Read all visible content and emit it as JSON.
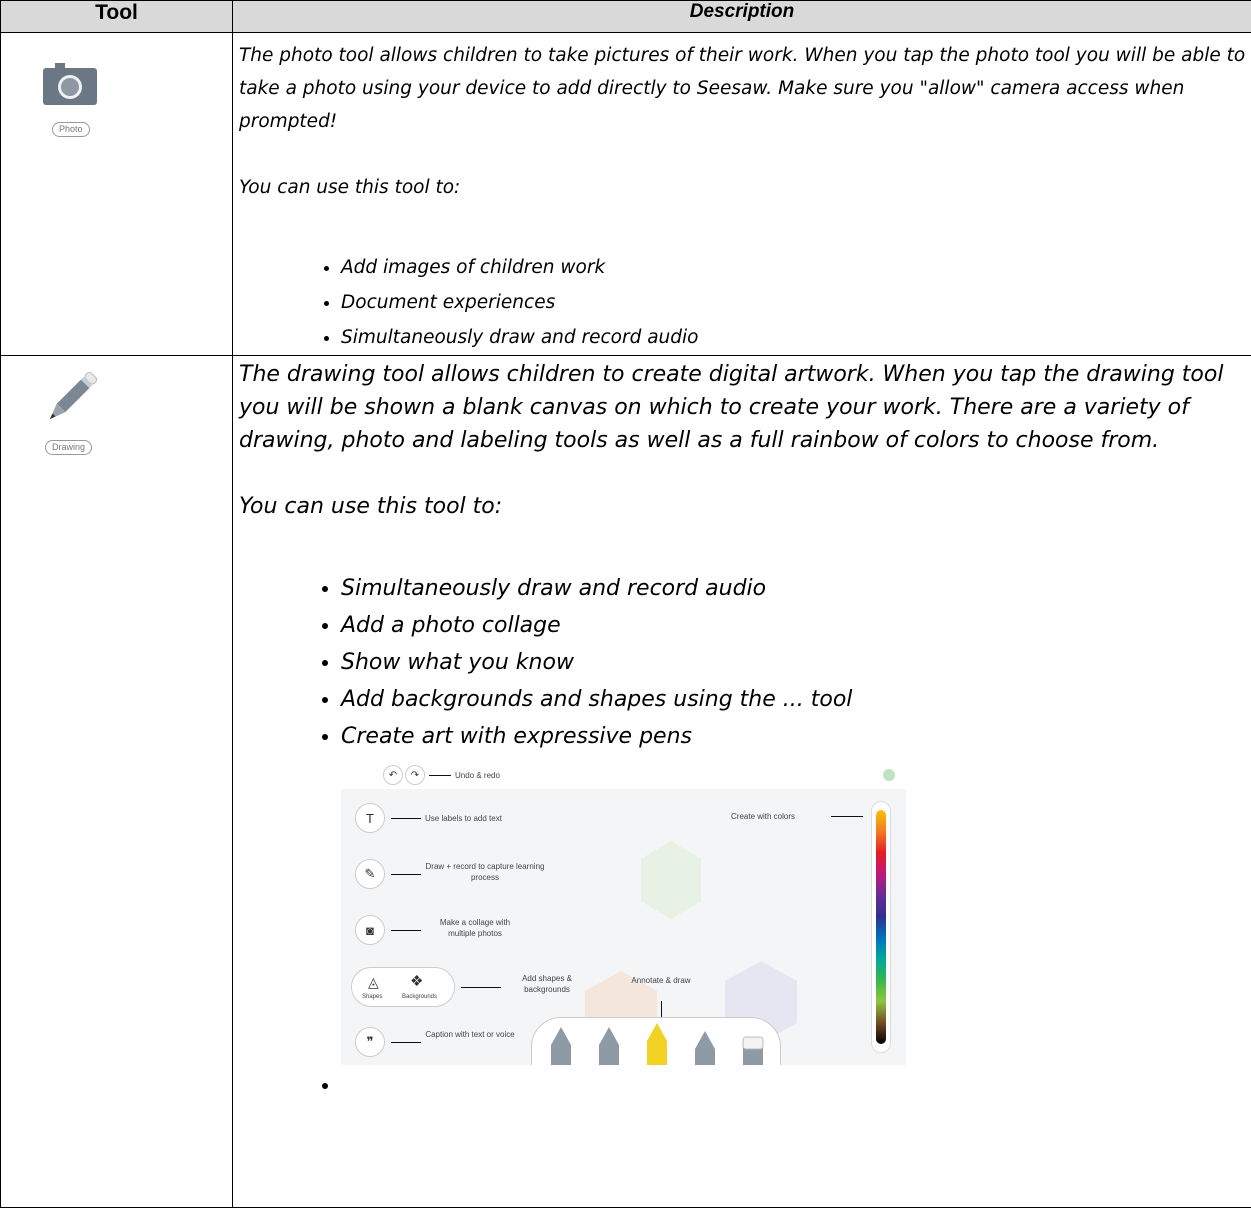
{
  "header": {
    "tool": "Tool",
    "description": "Description"
  },
  "rows": [
    {
      "tool_icon": "camera-icon",
      "tool_label": "Photo",
      "paragraph": "The photo tool allows children to take pictures of their work. When you tap the photo tool you will be able to take a photo using your device to add directly to Seesaw. Make sure you \"allow\" camera access when prompted!",
      "use_intro": "You can use this tool to:",
      "bullets": [
        "Add images of children work",
        "Document experiences",
        "Simultaneously draw and record audio"
      ]
    },
    {
      "tool_icon": "pencil-icon",
      "tool_label": "Drawing",
      "paragraph": "The drawing tool allows children to create digital artwork. When you tap the drawing tool you will be shown a blank canvas on which to create your work. There are a variety of drawing, photo and labeling tools as well as a full rainbow of colors to choose from.",
      "use_intro": "You can use this tool to:",
      "bullets": [
        "Simultaneously draw and record audio",
        "Add a photo collage",
        "Show what you know",
        "Add backgrounds and shapes using the ... tool",
        "Create art with expressive pens",
        ""
      ]
    }
  ],
  "figure": {
    "undo_redo": "Undo & redo",
    "labels_text": "Use labels to add text",
    "draw_record": "Draw + record to capture learning process",
    "collage": "Make a collage with multiple photos",
    "shapes": "Add shapes & backgrounds",
    "annotate": "Annotate & draw",
    "caption": "Caption with text or voice",
    "colors": "Create with colors",
    "shapes_btn": "Shapes",
    "backgrounds_btn": "Backgrounds",
    "text_btn": "T"
  }
}
